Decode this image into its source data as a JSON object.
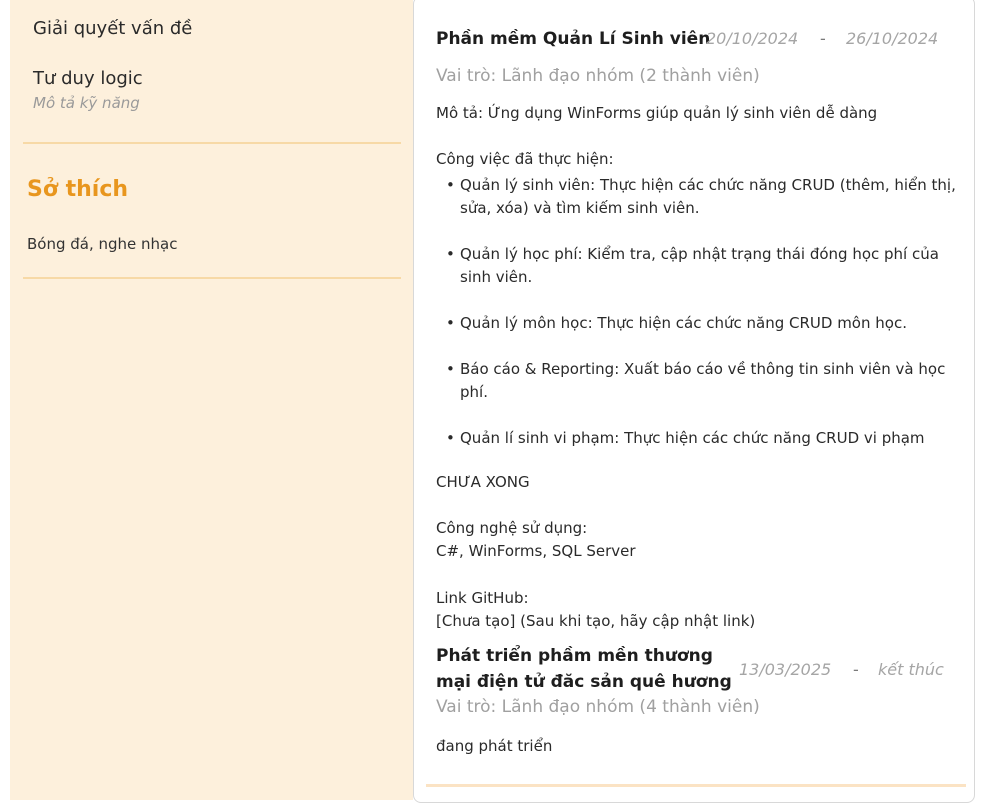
{
  "sidebar": {
    "skills": [
      {
        "name": "Giải quyết vấn đề"
      },
      {
        "name": "Tư duy logic",
        "description_placeholder": "Mô tả kỹ năng"
      }
    ],
    "hobbies": {
      "heading": "Sở thích",
      "text": "Bóng đá, nghe nhạc"
    }
  },
  "projects": [
    {
      "title": "Phần mềm Quản Lí Sinh viên",
      "start": "20/10/2024",
      "end": "26/10/2024",
      "separator": "-",
      "role": "Vai trò: Lãnh đạo nhóm (2 thành viên)",
      "description": "Mô tả: Ứng dụng WinForms giúp quản lý sinh viên dễ dàng",
      "tasks_heading": "Công việc đã thực hiện:",
      "tasks": [
        "Quản lý sinh viên: Thực hiện các chức năng CRUD (thêm, hiển thị, sửa, xóa) và tìm kiếm sinh viên.",
        "Quản lý học phí: Kiểm tra, cập nhật trạng thái đóng học phí của sinh viên.",
        "Quản lý môn học: Thực hiện các chức năng CRUD môn học.",
        "Báo cáo & Reporting: Xuất báo cáo về thông tin sinh viên và học phí.",
        "Quản lí sinh vi phạm: Thực hiện các chức năng CRUD vi phạm"
      ],
      "status": "CHƯA XONG",
      "tech_heading": "Công nghệ sử dụng:",
      "tech": "C#, WinForms, SQL Server",
      "github_heading": "Link GitHub:",
      "github": "[Chưa tạo] (Sau khi tạo, hãy cập nhật link)"
    },
    {
      "title_line1": "Phát triển phầm mền thương",
      "title_line2": "mại điện tử đăc sản quê hương",
      "start": "13/03/2025",
      "end": "kết thúc",
      "separator": "-",
      "role": "Vai trò: Lãnh đạo nhóm (4 thành viên)",
      "description": "đang phát triển"
    }
  ]
}
